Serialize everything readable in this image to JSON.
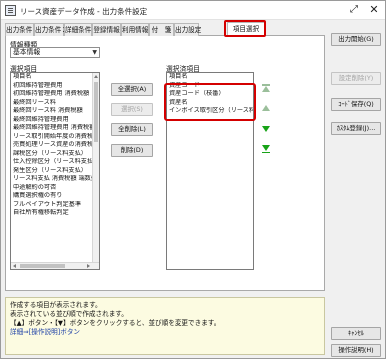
{
  "window": {
    "title": "リース資産データ作成 - 出力条件設定",
    "maximize_icon": "expand-arrows-icon",
    "close_icon": "close-icon"
  },
  "tabs": [
    {
      "label": "出力条件１"
    },
    {
      "label": "出力条件２"
    },
    {
      "label": "詳細条件"
    },
    {
      "label": "登録情報"
    },
    {
      "label": "利用情報"
    },
    {
      "label": "付　箋"
    },
    {
      "label": "出力設定"
    },
    {
      "label": "項目選択"
    }
  ],
  "active_tab": "項目選択",
  "info_type": {
    "label": "情報種類",
    "value": "基本情報"
  },
  "available": {
    "label": "選択項目",
    "items": [
      "項目名",
      "初回維持管理費用",
      "初回維持管理費用 消費税額",
      "最終回リース料",
      "最終回リース料 消費税額",
      "最終回維持管理費用",
      "最終回維持管理費用 消費税額",
      "リース取引開始年度の消費税",
      "売買処理リース資産の消費税",
      "課税区分（リース料支払）",
      "仕入控除区分（リース料支払）",
      "発生区分（リース料支払）",
      "リース料支払 消費税額 端数処",
      "中途解約の可否",
      "購買選択権の有り",
      "フルペイアウト判定基準",
      "自社所有権移転判定"
    ]
  },
  "selected": {
    "label": "選択済項目",
    "items": [
      "項目名",
      "資産コード",
      "資産コード（枝番）",
      "資産名",
      "インボイス取引区分（リース料支"
    ]
  },
  "middle_buttons": {
    "select_all": "全選択(A)",
    "select": "選択(S)",
    "remove_all": "全削除(L)",
    "remove": "削除(D)"
  },
  "right_buttons": {
    "output_start": "出力開始(G)",
    "setting_delete": "設定削除(Y)",
    "code_save": "ｺｰﾄﾞ保存(Q)",
    "katsu_register": "ｶｽﾀﾑ登録(J)...",
    "cancel": "ｷｬﾝｾﾙ",
    "operation_help": "操作説明(H)"
  },
  "info_box": {
    "lines": [
      "作成する項目が表示されます。",
      "表示されている並び順で作成されます。",
      "【▲】ボタン・【▼】ボタンをクリックすると、並び順を変更できます。"
    ],
    "link_text": "詳細⇒[操作説明]ボタン"
  },
  "colors": {
    "highlight": "#d40000",
    "arrow_active": "#17a317",
    "arrow_disabled": "#9bbf9b",
    "info_bg": "#fcfbe1"
  }
}
